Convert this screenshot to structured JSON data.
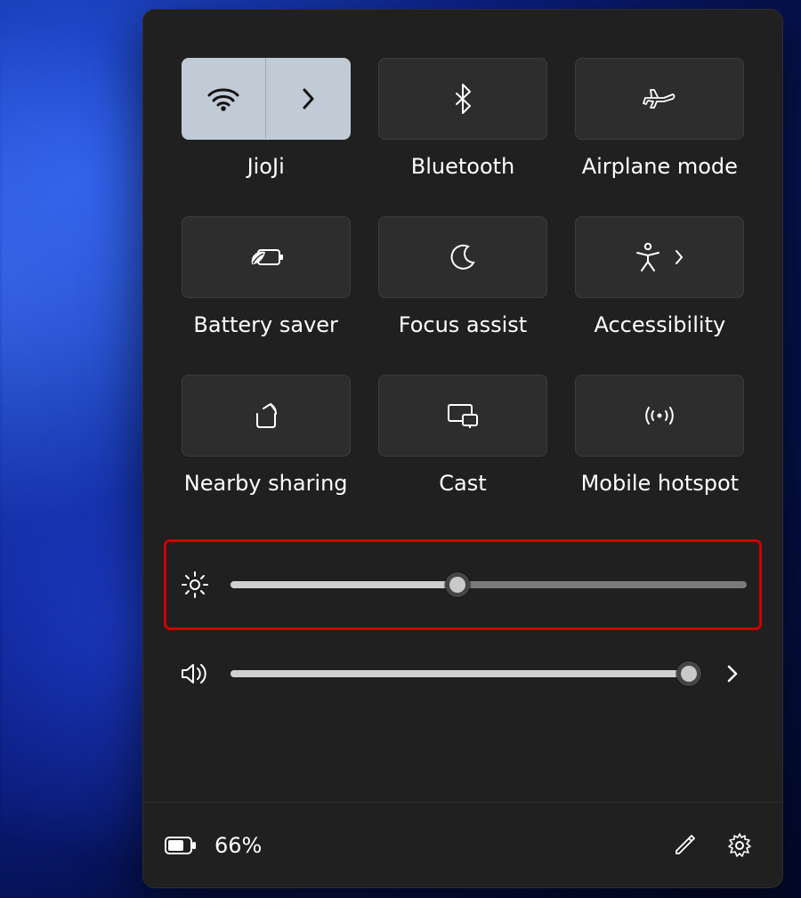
{
  "tiles": {
    "wifi": {
      "label": "JioJi"
    },
    "bluetooth": {
      "label": "Bluetooth"
    },
    "airplane": {
      "label": "Airplane mode"
    },
    "battery_saver": {
      "label": "Battery saver"
    },
    "focus_assist": {
      "label": "Focus assist"
    },
    "accessibility": {
      "label": "Accessibility"
    },
    "nearby_sharing": {
      "label": "Nearby sharing"
    },
    "cast": {
      "label": "Cast"
    },
    "hotspot": {
      "label": "Mobile hotspot"
    }
  },
  "sliders": {
    "brightness": {
      "percent": 44
    },
    "volume": {
      "percent": 98
    }
  },
  "footer": {
    "battery_text": "66%"
  },
  "highlight": "brightness"
}
